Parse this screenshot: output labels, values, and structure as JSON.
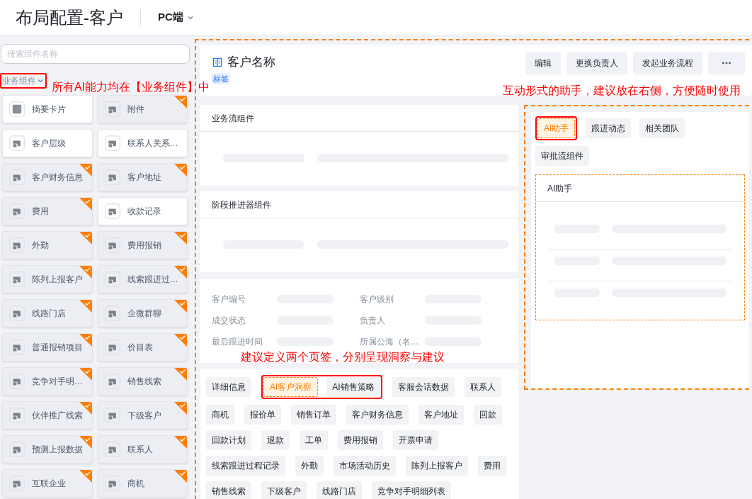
{
  "header": {
    "title": "布局配置-客户",
    "platform": "PC端"
  },
  "sidebar": {
    "search": {
      "placeholder": "搜索组件名称"
    },
    "section": {
      "label": "业务组件",
      "highlighted": true
    },
    "annotation": "所有AI能力均在【业务组件】中",
    "components": [
      {
        "label": "摘要卡片",
        "kind": "summary",
        "added": false
      },
      {
        "label": "附件",
        "kind": "component",
        "added": true
      },
      {
        "label": "客户层级",
        "kind": "component",
        "added": false
      },
      {
        "label": "联系人关系…",
        "kind": "component",
        "added": false
      },
      {
        "label": "客户财务信息",
        "kind": "component",
        "added": true
      },
      {
        "label": "客户地址",
        "kind": "component",
        "added": true
      },
      {
        "label": "费用",
        "kind": "component",
        "added": true
      },
      {
        "label": "收款记录",
        "kind": "component",
        "added": false
      },
      {
        "label": "外勤",
        "kind": "component",
        "added": true
      },
      {
        "label": "费用报销",
        "kind": "component",
        "added": true
      },
      {
        "label": "陈列上报客户",
        "kind": "component",
        "added": true
      },
      {
        "label": "线索跟进过…",
        "kind": "component",
        "added": true
      },
      {
        "label": "线路门店",
        "kind": "component",
        "added": true
      },
      {
        "label": "企微群聊",
        "kind": "component",
        "added": true
      },
      {
        "label": "普通报销项目",
        "kind": "component",
        "added": true
      },
      {
        "label": "价目表",
        "kind": "component",
        "added": true
      },
      {
        "label": "竞争对手明…",
        "kind": "component",
        "added": true
      },
      {
        "label": "销售线索",
        "kind": "component",
        "added": true
      },
      {
        "label": "伙伴推广线索",
        "kind": "component",
        "added": true
      },
      {
        "label": "下级客户",
        "kind": "component",
        "added": true
      },
      {
        "label": "预测上报数据",
        "kind": "component",
        "added": true
      },
      {
        "label": "联系人",
        "kind": "component",
        "added": true
      },
      {
        "label": "互联企业",
        "kind": "component",
        "added": true
      },
      {
        "label": "商机",
        "kind": "component",
        "added": true
      }
    ]
  },
  "record_header": {
    "title": "客户名称",
    "tag": "标签",
    "buttons": [
      "编辑",
      "更换负责人",
      "发起业务流程"
    ]
  },
  "main": {
    "cards": [
      {
        "title": "业务流组件"
      },
      {
        "title": "阶段推进器组件"
      }
    ],
    "fields": [
      {
        "label": "客户编号"
      },
      {
        "label": "客户级别"
      },
      {
        "label": "成交状态"
      },
      {
        "label": "负责人"
      },
      {
        "label": "最后跟进时间"
      },
      {
        "label": "所属公海（名…"
      }
    ],
    "annotation": "建议定义两个页签，分别呈现洞察与建议",
    "tabs": [
      {
        "label": "详细信息",
        "selected": false,
        "highlighted": false
      },
      {
        "label": "AI客户洞察",
        "selected": true,
        "highlighted": true
      },
      {
        "label": "AI销售策略",
        "selected": false,
        "highlighted": true
      },
      {
        "label": "客服会话数据",
        "selected": false,
        "highlighted": false
      },
      {
        "label": "联系人",
        "selected": false,
        "highlighted": false
      },
      {
        "label": "商机",
        "selected": false,
        "highlighted": false
      },
      {
        "label": "报价单",
        "selected": false,
        "highlighted": false
      },
      {
        "label": "销售订单",
        "selected": false,
        "highlighted": false
      },
      {
        "label": "客户财务信息",
        "selected": false,
        "highlighted": false
      },
      {
        "label": "客户地址",
        "selected": false,
        "highlighted": false
      },
      {
        "label": "回款",
        "selected": false,
        "highlighted": false
      },
      {
        "label": "回款计划",
        "selected": false,
        "highlighted": false
      },
      {
        "label": "退款",
        "selected": false,
        "highlighted": false
      },
      {
        "label": "工单",
        "selected": false,
        "highlighted": false
      },
      {
        "label": "费用报销",
        "selected": false,
        "highlighted": false
      },
      {
        "label": "开票申请",
        "selected": false,
        "highlighted": false
      },
      {
        "label": "线索跟进过程记录",
        "selected": false,
        "highlighted": false
      },
      {
        "label": "外勤",
        "selected": false,
        "highlighted": false
      },
      {
        "label": "市场活动历史",
        "selected": false,
        "highlighted": false
      },
      {
        "label": "陈列上报客户",
        "selected": false,
        "highlighted": false
      },
      {
        "label": "费用",
        "selected": false,
        "highlighted": false
      },
      {
        "label": "销售线索",
        "selected": false,
        "highlighted": false
      },
      {
        "label": "下级客户",
        "selected": false,
        "highlighted": false
      },
      {
        "label": "线路门店",
        "selected": false,
        "highlighted": false
      },
      {
        "label": "竞争对手明细列表",
        "selected": false,
        "highlighted": false
      }
    ]
  },
  "right_panel": {
    "annotation": "互动形式的助手，建议放在右侧，方便随时使用",
    "tabs": [
      {
        "label": "AI助手",
        "selected": true,
        "highlighted": true
      },
      {
        "label": "跟进动态",
        "selected": false,
        "highlighted": false
      },
      {
        "label": "相关团队",
        "selected": false,
        "highlighted": false
      },
      {
        "label": "审批流组件",
        "selected": false,
        "highlighted": false
      }
    ],
    "panel_title": "AI助手"
  }
}
